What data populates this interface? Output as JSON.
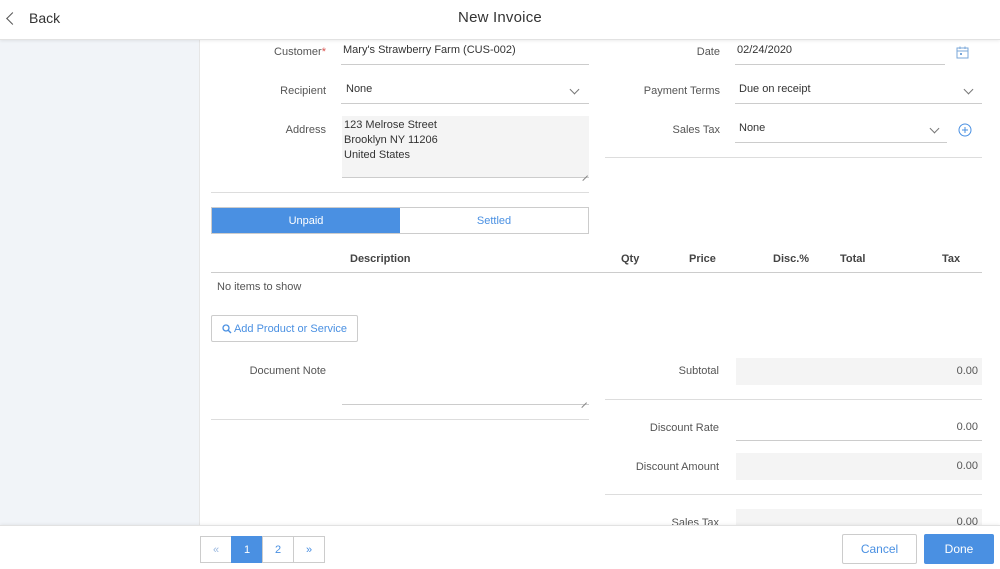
{
  "header": {
    "back_label": "Back",
    "title": "New Invoice"
  },
  "form": {
    "customer": {
      "label": "Customer",
      "required_mark": "*",
      "value": "Mary's Strawberry Farm (CUS-002)"
    },
    "recipient": {
      "label": "Recipient",
      "value": "None"
    },
    "address": {
      "label": "Address",
      "line1": "123 Melrose Street",
      "line2": "Brooklyn NY 11206",
      "line3": "United States"
    },
    "date": {
      "label": "Date",
      "value": "02/24/2020"
    },
    "payment_terms": {
      "label": "Payment Terms",
      "value": "Due on receipt"
    },
    "sales_tax": {
      "label": "Sales Tax",
      "value": "None"
    }
  },
  "status_tabs": {
    "unpaid": "Unpaid",
    "settled": "Settled",
    "active": "Unpaid"
  },
  "items_table": {
    "columns": {
      "description": "Description",
      "qty": "Qty",
      "price": "Price",
      "disc": "Disc.%",
      "total": "Total",
      "tax": "Tax"
    },
    "empty_text": "No items to show"
  },
  "add_item_button": "Add Product or Service",
  "document_note": {
    "label": "Document Note",
    "value": ""
  },
  "summary": {
    "subtotal": {
      "label": "Subtotal",
      "value": "0.00"
    },
    "discount_rate": {
      "label": "Discount Rate",
      "value": "0.00"
    },
    "discount_amount": {
      "label": "Discount Amount",
      "value": "0.00"
    },
    "sales_tax": {
      "label": "Sales Tax",
      "value": "0.00"
    }
  },
  "pagination": {
    "prev": "«",
    "pages": [
      "1",
      "2"
    ],
    "current": "1",
    "next": "»"
  },
  "footer": {
    "cancel": "Cancel",
    "done": "Done"
  },
  "colors": {
    "accent": "#4a90e2",
    "sidebar_bg": "#f1f4f8",
    "required": "#d9534f"
  }
}
